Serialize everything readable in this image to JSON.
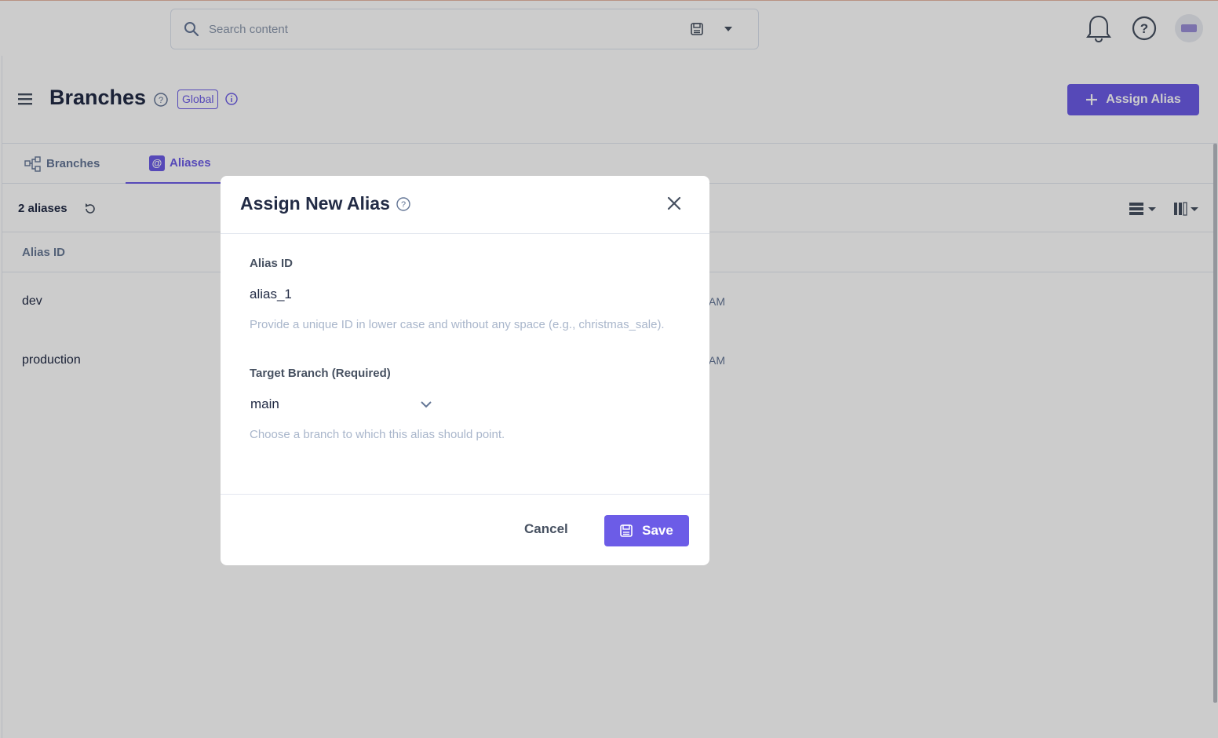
{
  "topbar": {
    "search_placeholder": "Search content",
    "icons": [
      "search-icon",
      "save-icon",
      "caret-down-icon",
      "bell-icon",
      "help-icon",
      "avatar"
    ]
  },
  "header": {
    "title": "Branches",
    "badge": "Global",
    "assign_button": "Assign Alias"
  },
  "tabs": [
    {
      "label": "Branches",
      "active": false
    },
    {
      "label": "Aliases",
      "active": true
    }
  ],
  "toolbar": {
    "count": "2 aliases"
  },
  "table": {
    "column_header": "Alias ID",
    "rows": [
      {
        "alias_id": "dev",
        "time_fragment": "AM"
      },
      {
        "alias_id": "production",
        "time_fragment": "AM"
      }
    ]
  },
  "modal": {
    "title": "Assign New Alias",
    "alias_label": "Alias ID",
    "alias_value": "alias_1",
    "alias_help": "Provide a unique ID in lower case and without any space (e.g., christmas_sale).",
    "branch_label": "Target Branch  (Required)",
    "branch_value": "main",
    "branch_help": "Choose a branch to which this alias should point.",
    "cancel_label": "Cancel",
    "save_label": "Save"
  },
  "colors": {
    "accent": "#6c5ce7",
    "text": "#222b45",
    "muted": "#647696",
    "overlay": "rgba(0,0,0,0.2)"
  }
}
